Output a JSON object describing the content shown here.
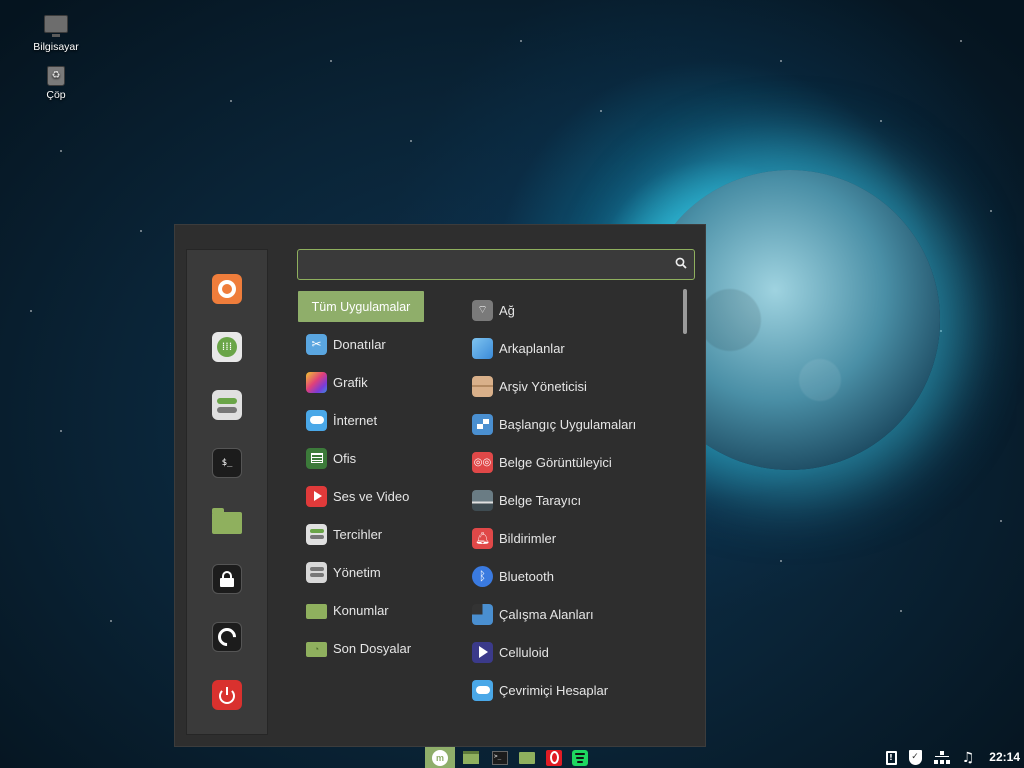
{
  "desktop": {
    "icons": [
      {
        "label": "Bilgisayar",
        "icon": "computer-icon"
      },
      {
        "label": "Çöp",
        "icon": "trash-icon"
      }
    ]
  },
  "menu": {
    "search": {
      "value": "",
      "placeholder": ""
    },
    "favorites": [
      {
        "name": "firefox",
        "icon": "firefox-icon",
        "color": "#ef7d3b"
      },
      {
        "name": "software-manager",
        "icon": "software-manager-icon",
        "color": "#e8e8e8"
      },
      {
        "name": "settings",
        "icon": "toggles-icon",
        "color": "#e0e0e0"
      },
      {
        "name": "terminal",
        "icon": "terminal-icon",
        "color": "#1e1e1e"
      },
      {
        "name": "files",
        "icon": "folder-icon",
        "color": "#8fb05e"
      },
      {
        "name": "lock-screen",
        "icon": "lock-icon",
        "color": "#1e1e1e"
      },
      {
        "name": "logout",
        "icon": "logout-icon",
        "color": "#1e1e1e"
      },
      {
        "name": "shutdown",
        "icon": "power-icon",
        "color": "#d9312e"
      }
    ],
    "categories": [
      {
        "label": "Tüm Uygulamalar",
        "active": true
      },
      {
        "label": "Donatılar",
        "icon": "scissors-icon",
        "color": "#5aa6e0"
      },
      {
        "label": "Grafik",
        "icon": "palette-icon",
        "color": "#b84cd0"
      },
      {
        "label": "İnternet",
        "icon": "cloud-icon",
        "color": "#4aa8e8"
      },
      {
        "label": "Ofis",
        "icon": "office-icon",
        "color": "#3c7a3a"
      },
      {
        "label": "Ses ve Video",
        "icon": "play-icon",
        "color": "#e03a3a"
      },
      {
        "label": "Tercihler",
        "icon": "toggles-icon",
        "color": "#e0e0e0"
      },
      {
        "label": "Yönetim",
        "icon": "toggles-icon",
        "color": "#d8d8d8"
      },
      {
        "label": "Konumlar",
        "icon": "folder-icon",
        "color": "#8fb05e"
      },
      {
        "label": "Son Dosyalar",
        "icon": "recent-folder-icon",
        "color": "#8fb05e"
      }
    ],
    "apps": [
      {
        "label": "Ağ",
        "icon": "wifi-icon",
        "color": "#7a7a7a"
      },
      {
        "label": "Arkaplanlar",
        "icon": "wallpaper-icon",
        "color": "#5aa6e0"
      },
      {
        "label": "Arşiv Yöneticisi",
        "icon": "archive-icon",
        "color": "#d9b08a"
      },
      {
        "label": "Başlangıç Uygulamaları",
        "icon": "startup-icon",
        "color": "#4a8fd0"
      },
      {
        "label": "Belge Görüntüleyici",
        "icon": "glasses-icon",
        "color": "#e04848"
      },
      {
        "label": "Belge Tarayıcı",
        "icon": "scanner-icon",
        "color": "#5a6a70"
      },
      {
        "label": "Bildirimler",
        "icon": "bell-icon",
        "color": "#e04848"
      },
      {
        "label": "Bluetooth",
        "icon": "bluetooth-icon",
        "color": "#3a7ae0"
      },
      {
        "label": "Çalışma Alanları",
        "icon": "workspaces-icon",
        "color": "#4a8fd0"
      },
      {
        "label": "Celluloid",
        "icon": "celluloid-icon",
        "color": "#3b3a8a"
      },
      {
        "label": "Çevrimiçi Hesaplar",
        "icon": "cloud-icon",
        "color": "#4aa8e8"
      }
    ]
  },
  "taskbar": {
    "items": [
      {
        "name": "menu-button",
        "icon": "mint-logo-icon"
      },
      {
        "name": "show-desktop",
        "icon": "desktop-icon"
      },
      {
        "name": "terminal",
        "icon": "terminal-icon"
      },
      {
        "name": "files",
        "icon": "folder-icon"
      },
      {
        "name": "opera",
        "icon": "opera-icon"
      },
      {
        "name": "spotify",
        "icon": "spotify-icon"
      }
    ],
    "tray": [
      "clipboard-icon",
      "shield-icon",
      "network-icon",
      "music-icon"
    ],
    "clock": "22:14"
  }
}
